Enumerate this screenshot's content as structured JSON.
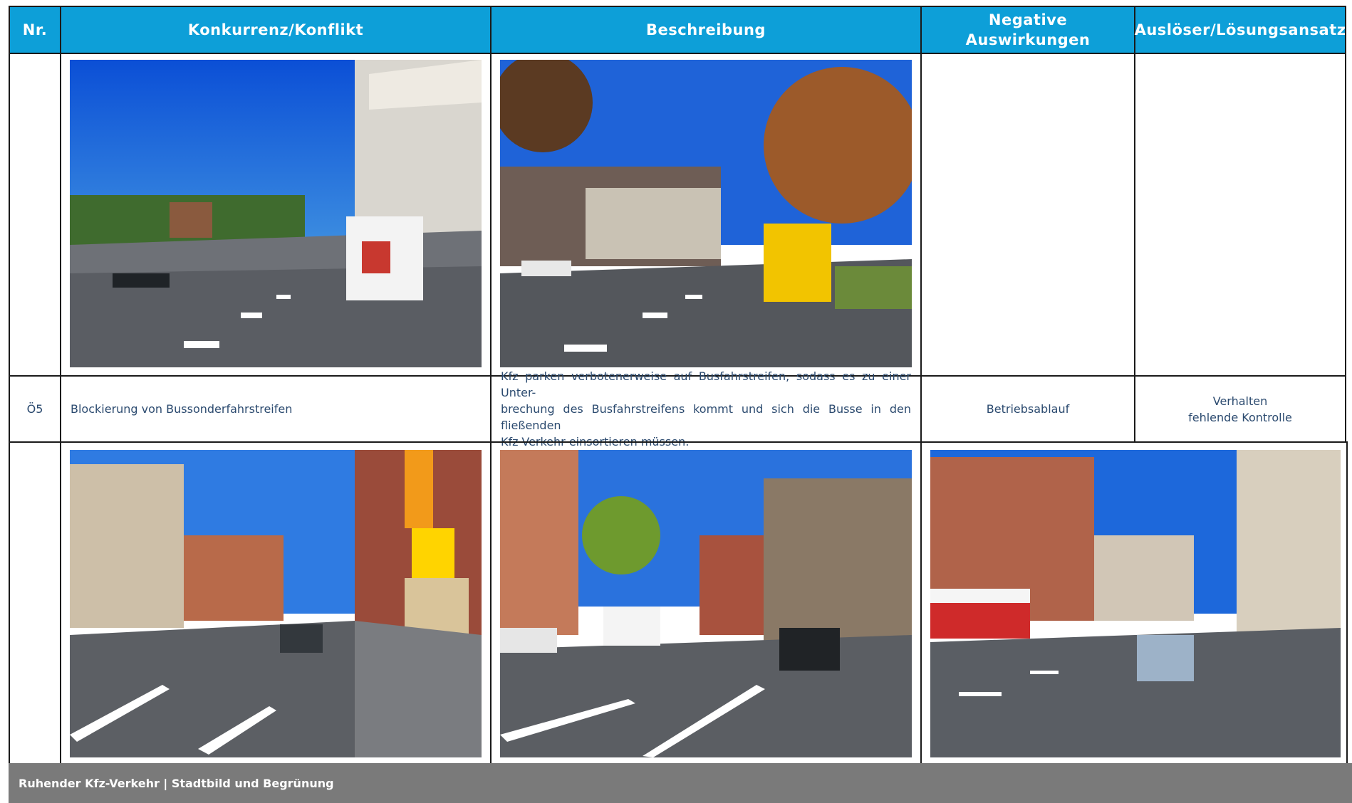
{
  "table": {
    "headers": {
      "nr": "Nr.",
      "konflikt": "Konkurrenz/Konflikt",
      "beschreibung": "Beschreibung",
      "negative_line1": "Negative",
      "negative_line2": "Auswirkungen",
      "ausloeser": "Auslöser/Lösungsansatz"
    },
    "entry": {
      "nr": "Ö5",
      "konflikt": "Blockierung von Bussonderfahrstreifen",
      "beschreibung_line1": "Kfz parken verbotenerweise auf Busfahrstreifen, sodass es zu einer Unter-",
      "beschreibung_line2": "brechung des Busfahrstreifens kommt und sich die Busse in den fließenden",
      "beschreibung_line3": "Kfz-Verkehr einsortieren müssen.",
      "negative": "Betriebsablauf",
      "ausloeser_line1": "Verhalten",
      "ausloeser_line2": "fehlende Kontrolle"
    }
  },
  "footer": {
    "text": "Ruhender Kfz-Verkehr | Stadtbild und Begrünung"
  },
  "colors": {
    "header_blue": "#0d9fd8",
    "text_blue": "#2b4a6f",
    "footer_gray": "#7a7a7a"
  }
}
